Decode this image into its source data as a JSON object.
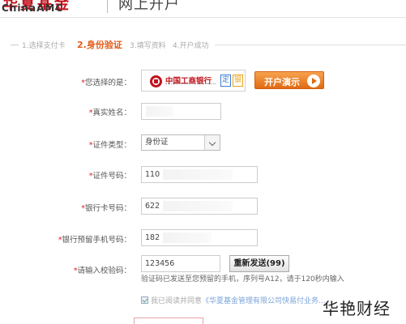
{
  "header": {
    "logo_cn": "华夏基金",
    "logo_en": "ChinaAMC",
    "page_title": "网上开户"
  },
  "steps": [
    {
      "label": "1.选择支付卡",
      "active": false
    },
    {
      "label": "2.身份验证",
      "active": true
    },
    {
      "label": "3.填写资料",
      "active": false
    },
    {
      "label": "4.开户成功",
      "active": false
    }
  ],
  "form": {
    "bank": {
      "label": "您选择的是：",
      "bank_name": "中国工商银行",
      "tag1": "定",
      "tag2": "银",
      "demo_button": "开户演示"
    },
    "real_name": {
      "label": "真实姓名：",
      "value": ""
    },
    "id_type": {
      "label": "证件类型：",
      "selected": "身份证"
    },
    "id_number": {
      "label": "证件号码：",
      "value": "110"
    },
    "card_number": {
      "label": "银行卡号码：",
      "value": "622"
    },
    "phone": {
      "label": "银行预留手机号码：",
      "value": "182"
    },
    "verify_code": {
      "label": "请输入校验码：",
      "value": "123456",
      "resend_button": "重新发送(99)"
    },
    "hint": "验证码已发送至您预留的手机，序列号A12，请于120秒内输入",
    "agreement": {
      "prefix": "我已阅读并同意",
      "link": "《华夏基金管理有限公司快易付业务..."
    }
  },
  "watermark": "华艳财经",
  "colors": {
    "accent": "#e35d1b",
    "brand_red": "#c1121c",
    "button_orange": "#e06a12",
    "link_blue": "#7aa4d8"
  }
}
